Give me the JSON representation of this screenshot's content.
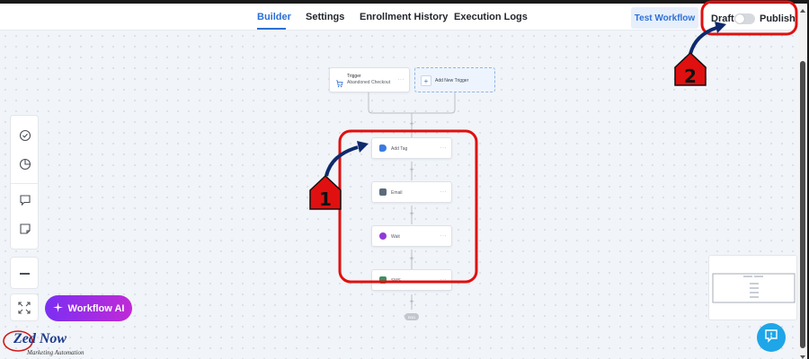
{
  "tabs": [
    {
      "label": "Builder",
      "active": true
    },
    {
      "label": "Settings",
      "active": false
    },
    {
      "label": "Enrollment History",
      "active": false
    },
    {
      "label": "Execution Logs",
      "active": false
    }
  ],
  "header": {
    "test_button": "Test Workflow",
    "draft_label": "Draft",
    "publish_label": "Publish",
    "publish_toggle_on": false
  },
  "trigger": {
    "title": "Trigger",
    "subtitle": "Abandoned Checkout"
  },
  "add_trigger": {
    "label": "Add New Trigger"
  },
  "actions": [
    {
      "label": "Add Tag",
      "icon": "tag-icon",
      "color": "#3b7be0"
    },
    {
      "label": "Email",
      "icon": "envelope-icon",
      "color": "#5b6b7d"
    },
    {
      "label": "Wait",
      "icon": "clock-icon",
      "color": "#8e3bd6"
    },
    {
      "label": "SMS",
      "icon": "chat-icon",
      "color": "#3e8f63"
    }
  ],
  "end_label": "END",
  "workflow_ai": {
    "label": "Workflow AI"
  },
  "annotations": [
    {
      "number": "1",
      "color": "#e01010"
    },
    {
      "number": "2",
      "color": "#e01010"
    }
  ],
  "logo": {
    "brand": "Zed Now",
    "tagline": "Marketing Automation"
  },
  "colors": {
    "accent": "#2d6fd6",
    "annotation": "#e01010",
    "arrow": "#0d2a6e"
  }
}
